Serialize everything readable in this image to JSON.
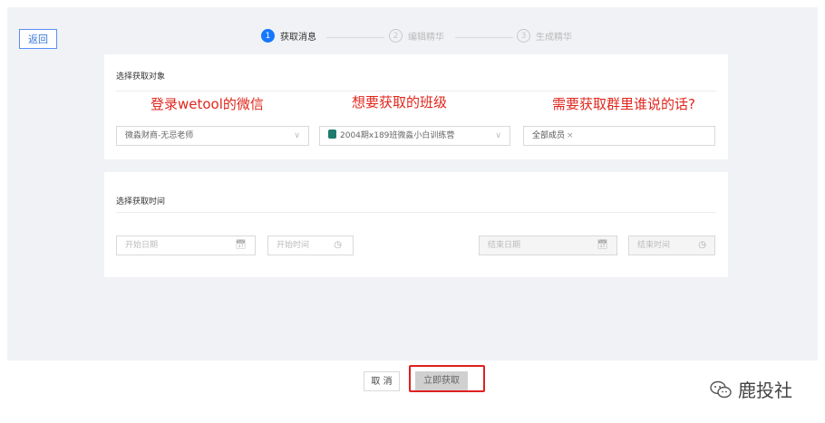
{
  "header": {
    "back_label": "返回"
  },
  "steps": [
    {
      "num": "1",
      "label": "获取消息",
      "state": "active"
    },
    {
      "num": "2",
      "label": "编辑精华",
      "state": "inactive"
    },
    {
      "num": "3",
      "label": "生成精华",
      "state": "inactive"
    }
  ],
  "target_section": {
    "title": "选择获取对象",
    "annotations": [
      "登录wetool的微信",
      "想要获取的班级",
      "需要获取群里谁说的话?"
    ],
    "account_select": {
      "value": "微淼财商-无忌老师"
    },
    "group_select": {
      "value": "2004期x189班微淼小白训练营"
    },
    "member_select": {
      "tag": "全部成员",
      "tag_remove": "×"
    }
  },
  "time_section": {
    "title": "选择获取时间",
    "start_date_placeholder": "开始日期",
    "start_time_placeholder": "开始时间",
    "end_date_placeholder": "结束日期",
    "end_time_placeholder": "结束时间"
  },
  "footer": {
    "cancel_label": "取 消",
    "confirm_label": "立即获取"
  },
  "watermark": {
    "text": "鹿投社",
    "icon": "wechat-icon"
  },
  "colors": {
    "accent": "#1677ff",
    "annotation": "#e0261c",
    "highlight": "#e02020"
  }
}
